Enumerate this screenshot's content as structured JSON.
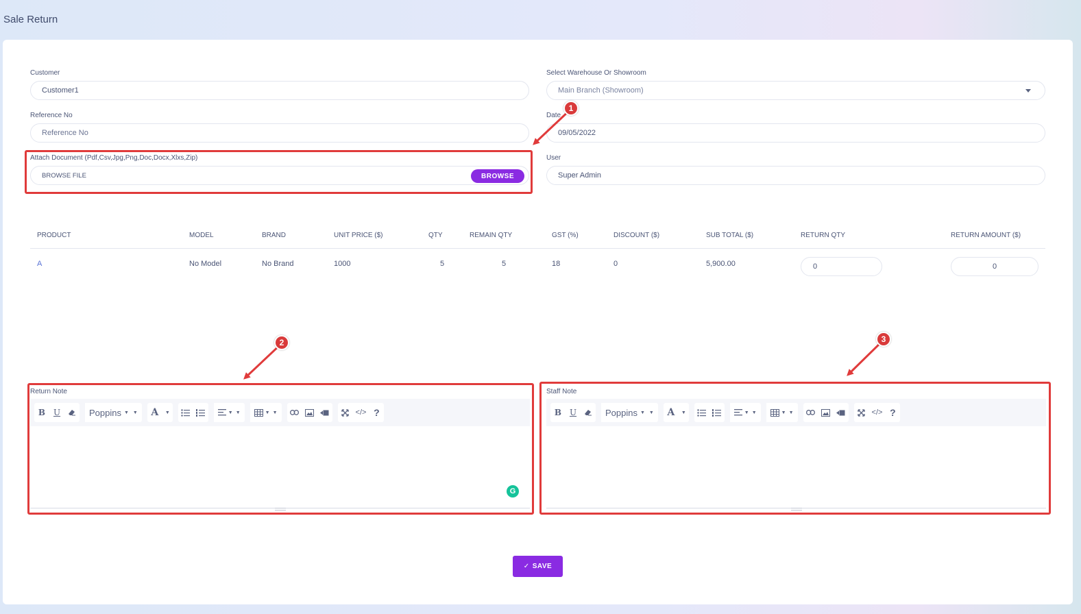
{
  "page": {
    "title": "Sale Return"
  },
  "form": {
    "customer": {
      "label": "Customer",
      "value": "Customer1"
    },
    "warehouse": {
      "label": "Select Warehouse Or Showroom",
      "value": "Main Branch (Showroom)"
    },
    "reference": {
      "label": "Reference No",
      "placeholder": "Reference No"
    },
    "date": {
      "label": "Date",
      "value": "09/05/2022"
    },
    "attach": {
      "label": "Attach Document (Pdf,Csv,Jpg,Png,Doc,Docx,Xlxs,Zip)",
      "file_text": "BROWSE FILE",
      "button": "BROWSE"
    },
    "user": {
      "label": "User",
      "value": "Super Admin"
    }
  },
  "table": {
    "headers": [
      "PRODUCT",
      "MODEL",
      "BRAND",
      "UNIT PRICE ($)",
      "QTY",
      "REMAIN QTY",
      "GST (%)",
      "DISCOUNT ($)",
      "SUB TOTAL ($)",
      "RETURN QTY",
      "RETURN AMOUNT ($)"
    ],
    "rows": [
      {
        "product": "A",
        "model": "No Model",
        "brand": "No Brand",
        "unit_price": "1000",
        "qty": "5",
        "remain_qty": "5",
        "gst": "18",
        "discount": "0",
        "sub_total": "5,900.00",
        "return_qty": "0",
        "return_amount": "0"
      }
    ]
  },
  "editors": {
    "return_note": {
      "label": "Return Note",
      "font": "Poppins"
    },
    "staff_note": {
      "label": "Staff Note",
      "font": "Poppins"
    }
  },
  "toolbar_glyphs": {
    "bold": "B",
    "underline": "U",
    "font_color": "A",
    "help": "?",
    "code": "</>"
  },
  "grammarly_glyph": "G",
  "annotations": {
    "badge1": "1",
    "badge2": "2",
    "badge3": "3"
  },
  "save": {
    "check": "✓",
    "label": "SAVE"
  },
  "colors": {
    "accent": "#8a2be2",
    "highlight": "#e03b3b",
    "grammarly": "#15c39a"
  }
}
